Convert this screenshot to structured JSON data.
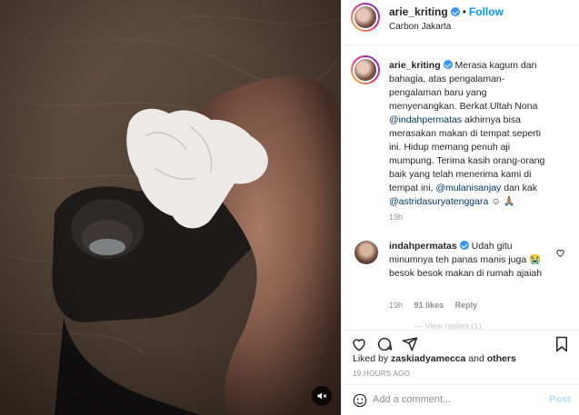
{
  "header": {
    "username": "arie_kriting",
    "dot": "•",
    "follow_label": "Follow",
    "location": "Carbon Jakarta"
  },
  "caption": {
    "username": "arie_kriting",
    "text_a": "Merasa kagum dan bahagia, atas pengalaman-pengalaman baru yang menyenangkan. Berkat Ultah Nona ",
    "mention_1": "@indahpermatas",
    "text_b": " akhirnya bisa merasakan makan di tempat seperti ini. Hidup memang penuh aji mumpung. Terima kasih orang-orang baik yang telah menerima kami di tempat ini, ",
    "mention_2": "@mulanisanjay",
    "text_c": " dan kak ",
    "mention_3": "@astridasuryatenggara",
    "text_d": " ☺ 🙏🏽",
    "time": "19h"
  },
  "comment": {
    "username": "indahpermatas",
    "text": "Udah gitu minumnya teh panas manis juga 😭 besok besok makan di rumah ajaiah",
    "time": "19h",
    "likes": "91 likes",
    "reply": "Reply"
  },
  "faded_text": "— View replies (1)",
  "likes_line": {
    "prefix": "Liked by ",
    "user": "zaskiadyamecca",
    "suffix": " and ",
    "others": "others"
  },
  "timestamp": "19 HOURS AGO",
  "add_comment": {
    "placeholder": "Add a comment...",
    "post_label": "Post"
  },
  "colors": {
    "link": "#0095f6",
    "mention": "#00376b",
    "verified": "#3897f0",
    "muted": "#8e8e8e"
  },
  "icons": [
    "mute-icon",
    "heart-icon",
    "comment-icon",
    "share-icon",
    "bookmark-icon",
    "emoji-icon",
    "verified-icon"
  ]
}
